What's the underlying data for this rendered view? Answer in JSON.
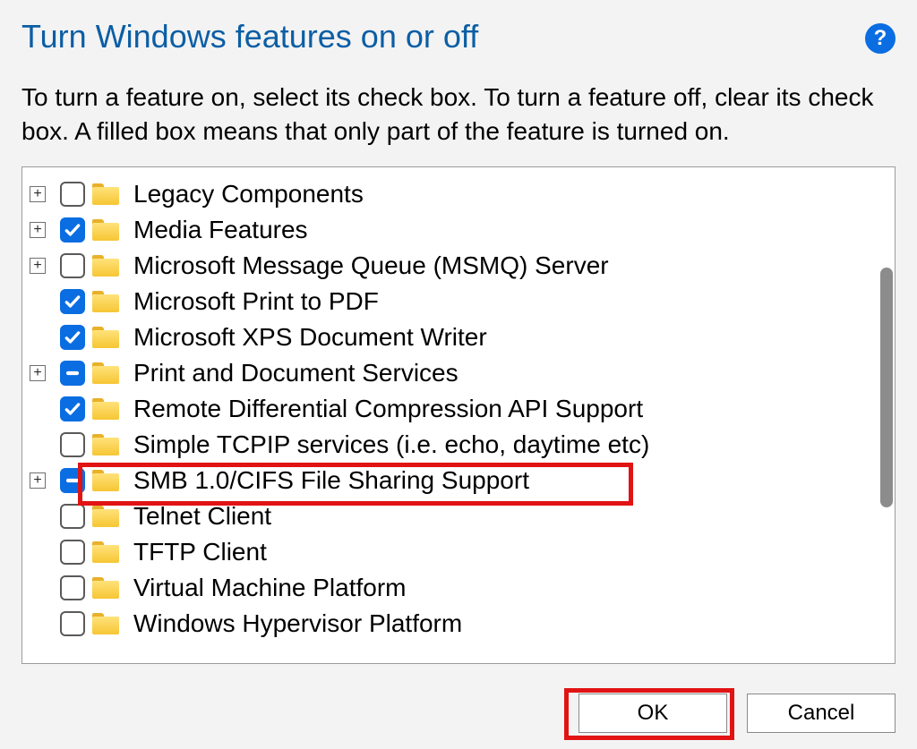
{
  "title": "Turn Windows features on or off",
  "help_label": "?",
  "description": "To turn a feature on, select its check box. To turn a feature off, clear its check box. A filled box means that only part of the feature is turned on.",
  "features": [
    {
      "label": "Legacy Components",
      "state": "unchecked",
      "expandable": true
    },
    {
      "label": "Media Features",
      "state": "checked",
      "expandable": true
    },
    {
      "label": "Microsoft Message Queue (MSMQ) Server",
      "state": "unchecked",
      "expandable": true
    },
    {
      "label": "Microsoft Print to PDF",
      "state": "checked",
      "expandable": false
    },
    {
      "label": "Microsoft XPS Document Writer",
      "state": "checked",
      "expandable": false
    },
    {
      "label": "Print and Document Services",
      "state": "partial",
      "expandable": true
    },
    {
      "label": "Remote Differential Compression API Support",
      "state": "checked",
      "expandable": false
    },
    {
      "label": "Simple TCPIP services (i.e. echo, daytime etc)",
      "state": "unchecked",
      "expandable": false
    },
    {
      "label": "SMB 1.0/CIFS File Sharing Support",
      "state": "partial",
      "expandable": true
    },
    {
      "label": "Telnet Client",
      "state": "unchecked",
      "expandable": false
    },
    {
      "label": "TFTP Client",
      "state": "unchecked",
      "expandable": false
    },
    {
      "label": "Virtual Machine Platform",
      "state": "unchecked",
      "expandable": false
    },
    {
      "label": "Windows Hypervisor Platform",
      "state": "unchecked",
      "expandable": false
    }
  ],
  "buttons": {
    "ok": "OK",
    "cancel": "Cancel"
  }
}
